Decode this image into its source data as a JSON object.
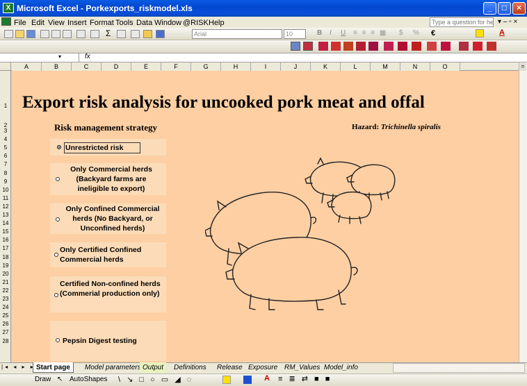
{
  "window": {
    "title": "Microsoft Excel - Porkexports_riskmodel.xls"
  },
  "menu": [
    "File",
    "Edit",
    "View",
    "Insert",
    "Format",
    "Tools",
    "Data",
    "Window",
    "@RISK",
    "Help"
  ],
  "help_placeholder": "Type a question for help",
  "font_combo": "Arial",
  "size_combo": "10",
  "name_box": "",
  "fx_label": "fx",
  "columns": [
    "A",
    "B",
    "C",
    "D",
    "E",
    "F",
    "G",
    "H",
    "I",
    "J",
    "K",
    "L",
    "M",
    "N",
    "O"
  ],
  "rows": [
    "1",
    "2",
    "3",
    "4",
    "5",
    "6",
    "7",
    "8",
    "9",
    "10",
    "11",
    "12",
    "13",
    "14",
    "15",
    "16",
    "17",
    "18",
    "19",
    "20",
    "21",
    "22",
    "23",
    "24",
    "25",
    "26",
    "27",
    "28"
  ],
  "sheet": {
    "title": "Export risk analysis for uncooked pork meat and offal",
    "rm_label": "Risk management strategy",
    "hazard_label": "Hazard:",
    "hazard_value": "Trichinella spiralis",
    "options": [
      {
        "label": "Unrestricted risk",
        "selected": true
      },
      {
        "label": "Only Commercial herds (Backyard farms are ineligible to export)",
        "selected": false
      },
      {
        "label": "Only Confined Commercial herds (No Backyard, or Unconfined herds)",
        "selected": false
      },
      {
        "label": "Only Certified Confined Commercial herds",
        "selected": false
      },
      {
        "label": "Certified Non-confined herds  (Commerial production only)",
        "selected": false
      },
      {
        "label": "Pepsin Digest testing",
        "selected": false
      }
    ]
  },
  "tabs": [
    "Start page",
    "Model parameters",
    "Output",
    "Definitions",
    "Release",
    "Exposure",
    "RM_Values",
    "Model_info"
  ],
  "drawbar": {
    "draw": "Draw",
    "autoshapes": "AutoShapes"
  },
  "colors": {
    "sheet_bg": "#fdcfa3",
    "option_bg": "#fcdcb8",
    "title_bar": "#0a5be4",
    "green_tab": "#e8f2c0"
  }
}
